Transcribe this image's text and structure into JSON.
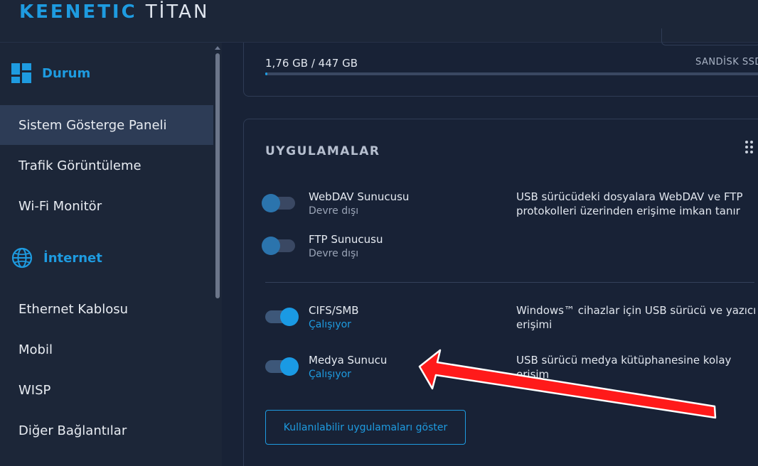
{
  "header": {
    "brand": "KEENETIC",
    "model": "TİTAN"
  },
  "sidebar": {
    "sections": [
      {
        "label": "Durum",
        "icon": "dashboard-grid-icon",
        "items": [
          {
            "label": "Sistem Gösterge Paneli",
            "active": true
          },
          {
            "label": "Trafik Görüntüleme",
            "active": false
          },
          {
            "label": "Wi-Fi Monitör",
            "active": false
          }
        ]
      },
      {
        "label": "İnternet",
        "icon": "globe-icon",
        "items": [
          {
            "label": "Ethernet Kablosu",
            "active": false
          },
          {
            "label": "Mobil",
            "active": false
          },
          {
            "label": "WISP",
            "active": false
          },
          {
            "label": "Diğer Bağlantılar",
            "active": false
          }
        ]
      }
    ]
  },
  "storage": {
    "usage": "1,76 GB / 447 GB",
    "device": "SANDİSK SSD",
    "fill_percent": 0.4
  },
  "apps": {
    "title": "UYGULAMALAR",
    "items": [
      {
        "name": "WebDAV Sunucusu",
        "status": "Devre dışı",
        "enabled": false,
        "description": "USB sürücüdeki dosyalara WebDAV ve FTP protokolleri üzerinden erişime imkan tanır"
      },
      {
        "name": "FTP Sunucusu",
        "status": "Devre dışı",
        "enabled": false,
        "description": ""
      },
      {
        "name": "CIFS/SMB",
        "status": "Çalışıyor",
        "enabled": true,
        "description": "Windows™ cihazlar için USB sürücü ve yazıcı erişimi"
      },
      {
        "name": "Medya Sunucu",
        "status": "Çalışıyor",
        "enabled": true,
        "description": "USB sürücü medya kütüphanesine kolay erişim"
      }
    ],
    "show_button": "Kullanılabilir uygulamaları göster"
  },
  "colors": {
    "accent": "#1e9be0",
    "arrow": "#ff1a1a"
  }
}
